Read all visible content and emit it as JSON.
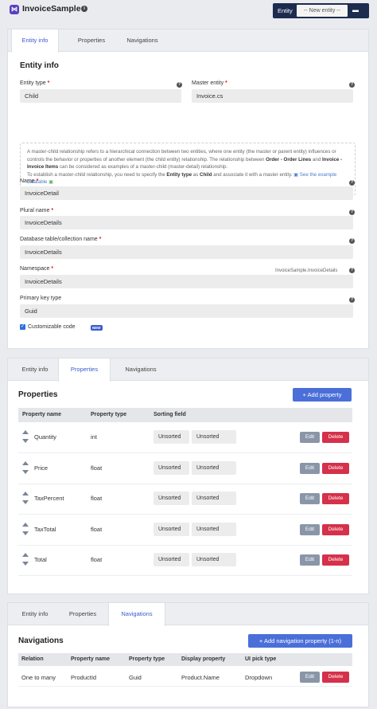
{
  "app": {
    "title": "InvoiceSample",
    "logo_glyph": "⋈"
  },
  "entity_selector": {
    "label": "Entity",
    "value": "-- New entity --"
  },
  "tabs": [
    "Entity info",
    "Properties",
    "Navigations"
  ],
  "entity_info": {
    "title": "Entity info",
    "entity_type": {
      "label": "Entity type",
      "value": "Child"
    },
    "master_entity": {
      "label": "Master entity",
      "value": "Invoice.cs"
    },
    "note": {
      "p1_a": "A master-child relationship refers to a hierarchical connection between two entities, where one entity (the master or parent entity) influences or controls the behavior or properties of another element (the child entity) relationship. The relationship between ",
      "p1_b": "Order - Order Lines",
      "p1_c": " and ",
      "p1_d": "Invoice - Invoice Items",
      "p1_e": " can be considered as examples of a master-child (master-detail) relationship.",
      "p2_a": "To establish a master-child relationship, you need to specify the ",
      "p2_b": "Entity type",
      "p2_c": " as ",
      "p2_d": "Child",
      "p2_e": " and associate it with a master entity. ",
      "link": "See the example datatable"
    },
    "name": {
      "label": "Name",
      "value": "InvoiceDetail"
    },
    "plural_name": {
      "label": "Plural name",
      "value": "InvoiceDetails"
    },
    "db_table": {
      "label": "Database table/collection name",
      "value": "InvoiceDetails"
    },
    "namespace": {
      "label": "Namespace",
      "value": "InvoiceDetails",
      "hint": "InvoiceSample.InvoiceDetails"
    },
    "primary_key": {
      "label": "Primary key type",
      "value": "Guid"
    },
    "customizable_code": {
      "label": "Customizable code",
      "badge": "NEW",
      "checked": true
    }
  },
  "properties": {
    "title": "Properties",
    "add_button": "+ Add property",
    "columns": [
      "Property name",
      "Property type",
      "Sorting field"
    ],
    "rows": [
      {
        "name": "Quantity",
        "type": "int",
        "sort1": "Unsorted",
        "sort2": "Unsorted"
      },
      {
        "name": "Price",
        "type": "float",
        "sort1": "Unsorted",
        "sort2": "Unsorted"
      },
      {
        "name": "TaxPercent",
        "type": "float",
        "sort1": "Unsorted",
        "sort2": "Unsorted"
      },
      {
        "name": "TaxTotal",
        "type": "float",
        "sort1": "Unsorted",
        "sort2": "Unsorted"
      },
      {
        "name": "Total",
        "type": "float",
        "sort1": "Unsorted",
        "sort2": "Unsorted"
      }
    ],
    "edit_label": "Edit",
    "delete_label": "Delete"
  },
  "navigations": {
    "title": "Navigations",
    "add_button": "+ Add navigation property (1-n)",
    "columns": [
      "Relation",
      "Property name",
      "Property type",
      "Display property",
      "UI pick type"
    ],
    "rows": [
      {
        "relation": "One to many",
        "property_name": "ProductId",
        "property_type": "Guid",
        "display_property": "Product.Name",
        "ui_pick_type": "Dropdown"
      }
    ],
    "edit_label": "Edit",
    "delete_label": "Delete"
  },
  "colors": {
    "accent": "#4a6fd8",
    "danger": "#d5314a",
    "nav_dark": "#1d2b4f"
  }
}
